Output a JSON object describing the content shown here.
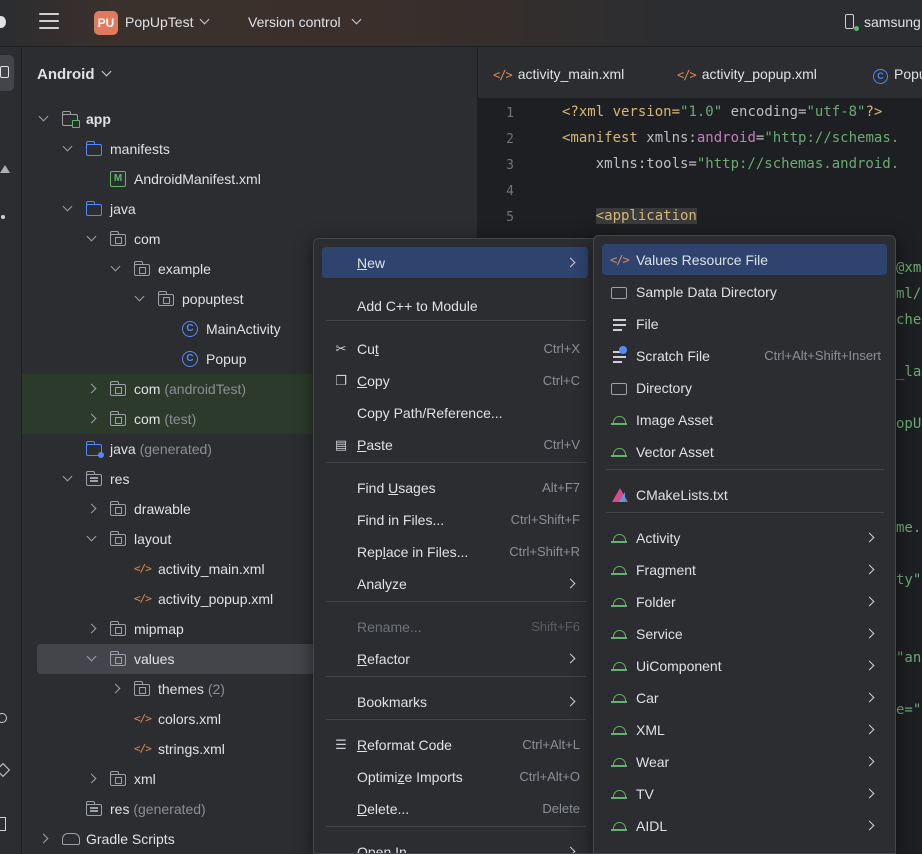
{
  "titlebar": {
    "project_badge": "PU",
    "project_name": "PopUpTest",
    "version_control": "Version control",
    "device": "samsung"
  },
  "project_panel": {
    "title": "Android",
    "tree": [
      {
        "label": "app",
        "suffix": "",
        "icon": "app-folder-icon"
      },
      {
        "label": "manifests",
        "suffix": "",
        "icon": "folder-icon"
      },
      {
        "label": "AndroidManifest.xml",
        "suffix": "",
        "icon": "manifest-icon"
      },
      {
        "label": "java",
        "suffix": "",
        "icon": "folder-icon"
      },
      {
        "label": "com",
        "suffix": "",
        "icon": "package-icon"
      },
      {
        "label": "example",
        "suffix": "",
        "icon": "package-icon"
      },
      {
        "label": "popuptest",
        "suffix": "",
        "icon": "package-icon"
      },
      {
        "label": "MainActivity",
        "suffix": "",
        "icon": "class-icon"
      },
      {
        "label": "Popup",
        "suffix": "",
        "icon": "class-icon"
      },
      {
        "label": "com",
        "suffix": "(androidTest)",
        "icon": "package-icon"
      },
      {
        "label": "com",
        "suffix": "(test)",
        "icon": "package-icon"
      },
      {
        "label": "java",
        "suffix": "(generated)",
        "icon": "generated-folder-icon"
      },
      {
        "label": "res",
        "suffix": "",
        "icon": "res-folder-icon"
      },
      {
        "label": "drawable",
        "suffix": "",
        "icon": "package-icon"
      },
      {
        "label": "layout",
        "suffix": "",
        "icon": "package-icon"
      },
      {
        "label": "activity_main.xml",
        "suffix": "",
        "icon": "xml-icon"
      },
      {
        "label": "activity_popup.xml",
        "suffix": "",
        "icon": "xml-icon"
      },
      {
        "label": "mipmap",
        "suffix": "",
        "icon": "package-icon"
      },
      {
        "label": "values",
        "suffix": "",
        "icon": "package-icon"
      },
      {
        "label": "themes",
        "suffix": "(2)",
        "icon": "package-icon"
      },
      {
        "label": "colors.xml",
        "suffix": "",
        "icon": "xml-icon"
      },
      {
        "label": "strings.xml",
        "suffix": "",
        "icon": "xml-icon"
      },
      {
        "label": "xml",
        "suffix": "",
        "icon": "package-icon"
      },
      {
        "label": "res",
        "suffix": "(generated)",
        "icon": "res-folder-icon"
      },
      {
        "label": "Gradle Scripts",
        "suffix": "",
        "icon": "gradle-icon"
      }
    ]
  },
  "editor": {
    "tabs": [
      "activity_main.xml",
      "activity_popup.xml",
      "Popup"
    ],
    "line_numbers": [
      "1",
      "2",
      "3",
      "4",
      "5"
    ],
    "code": {
      "l1_a": "<?xml version=",
      "l1_b": "\"1.0\"",
      "l1_c": " encoding=",
      "l1_d": "\"utf-8\"",
      "l1_e": "?>",
      "l2_a": "<manifest",
      "l2_b": " xmlns:",
      "l2_c": "android",
      "l2_d": "=",
      "l2_e": "\"http://schemas.",
      "l3_a": "    xmlns:tools=",
      "l3_b": "\"http://schemas.android.",
      "l5_a": "    ",
      "l5_b": "<application"
    },
    "fragments": [
      "@xm",
      "ml/",
      "che",
      "_la",
      "opU",
      "me.",
      "ty\"",
      "\"an",
      "e=\""
    ]
  },
  "context_menu": {
    "items": [
      {
        "label": "New",
        "shortcut": "",
        "submenu": true
      },
      {
        "label": "Add C++ to Module",
        "shortcut": ""
      },
      {
        "label": "Cut",
        "shortcut": "Ctrl+X",
        "icon": "scissors-icon"
      },
      {
        "label": "Copy",
        "shortcut": "Ctrl+C",
        "icon": "copy-icon"
      },
      {
        "label": "Copy Path/Reference...",
        "shortcut": ""
      },
      {
        "label": "Paste",
        "shortcut": "Ctrl+V",
        "icon": "paste-icon"
      },
      {
        "label": "Find Usages",
        "shortcut": "Alt+F7"
      },
      {
        "label": "Find in Files...",
        "shortcut": "Ctrl+Shift+F"
      },
      {
        "label": "Replace in Files...",
        "shortcut": "Ctrl+Shift+R"
      },
      {
        "label": "Analyze",
        "shortcut": "",
        "submenu": true
      },
      {
        "label": "Rename...",
        "shortcut": "Shift+F6",
        "disabled": true
      },
      {
        "label": "Refactor",
        "shortcut": "",
        "submenu": true
      },
      {
        "label": "Bookmarks",
        "shortcut": "",
        "submenu": true
      },
      {
        "label": "Reformat Code",
        "shortcut": "Ctrl+Alt+L",
        "icon": "reformat-icon"
      },
      {
        "label": "Optimize Imports",
        "shortcut": "Ctrl+Alt+O"
      },
      {
        "label": "Delete...",
        "shortcut": "Delete"
      },
      {
        "label": "Open In",
        "shortcut": "",
        "submenu": true
      }
    ]
  },
  "submenu": {
    "items": [
      {
        "label": "Values Resource File",
        "shortcut": "",
        "icon": "xml-file-icon"
      },
      {
        "label": "Sample Data Directory",
        "shortcut": "",
        "icon": "folder-icon"
      },
      {
        "label": "File",
        "shortcut": "",
        "icon": "file-icon"
      },
      {
        "label": "Scratch File",
        "shortcut": "Ctrl+Alt+Shift+Insert",
        "icon": "scratch-file-icon"
      },
      {
        "label": "Directory",
        "shortcut": "",
        "icon": "folder-icon"
      },
      {
        "label": "Image Asset",
        "shortcut": "",
        "icon": "android-icon"
      },
      {
        "label": "Vector Asset",
        "shortcut": "",
        "icon": "android-icon"
      },
      {
        "label": "CMakeLists.txt",
        "shortcut": "",
        "icon": "cmake-icon"
      },
      {
        "label": "Activity",
        "submenu": true,
        "icon": "android-icon"
      },
      {
        "label": "Fragment",
        "submenu": true,
        "icon": "android-icon"
      },
      {
        "label": "Folder",
        "submenu": true,
        "icon": "android-icon"
      },
      {
        "label": "Service",
        "submenu": true,
        "icon": "android-icon"
      },
      {
        "label": "UiComponent",
        "submenu": true,
        "icon": "android-icon"
      },
      {
        "label": "Car",
        "submenu": true,
        "icon": "android-icon"
      },
      {
        "label": "XML",
        "submenu": true,
        "icon": "android-icon"
      },
      {
        "label": "Wear",
        "submenu": true,
        "icon": "android-icon"
      },
      {
        "label": "TV",
        "submenu": true,
        "icon": "android-icon"
      },
      {
        "label": "AIDL",
        "submenu": true,
        "icon": "android-icon"
      }
    ]
  },
  "colors": {
    "selection": "#2e436e",
    "accent_blue": "#548af7",
    "android_green": "#5fb865",
    "xml_orange": "#e08855",
    "badge": "#e07a5f"
  }
}
